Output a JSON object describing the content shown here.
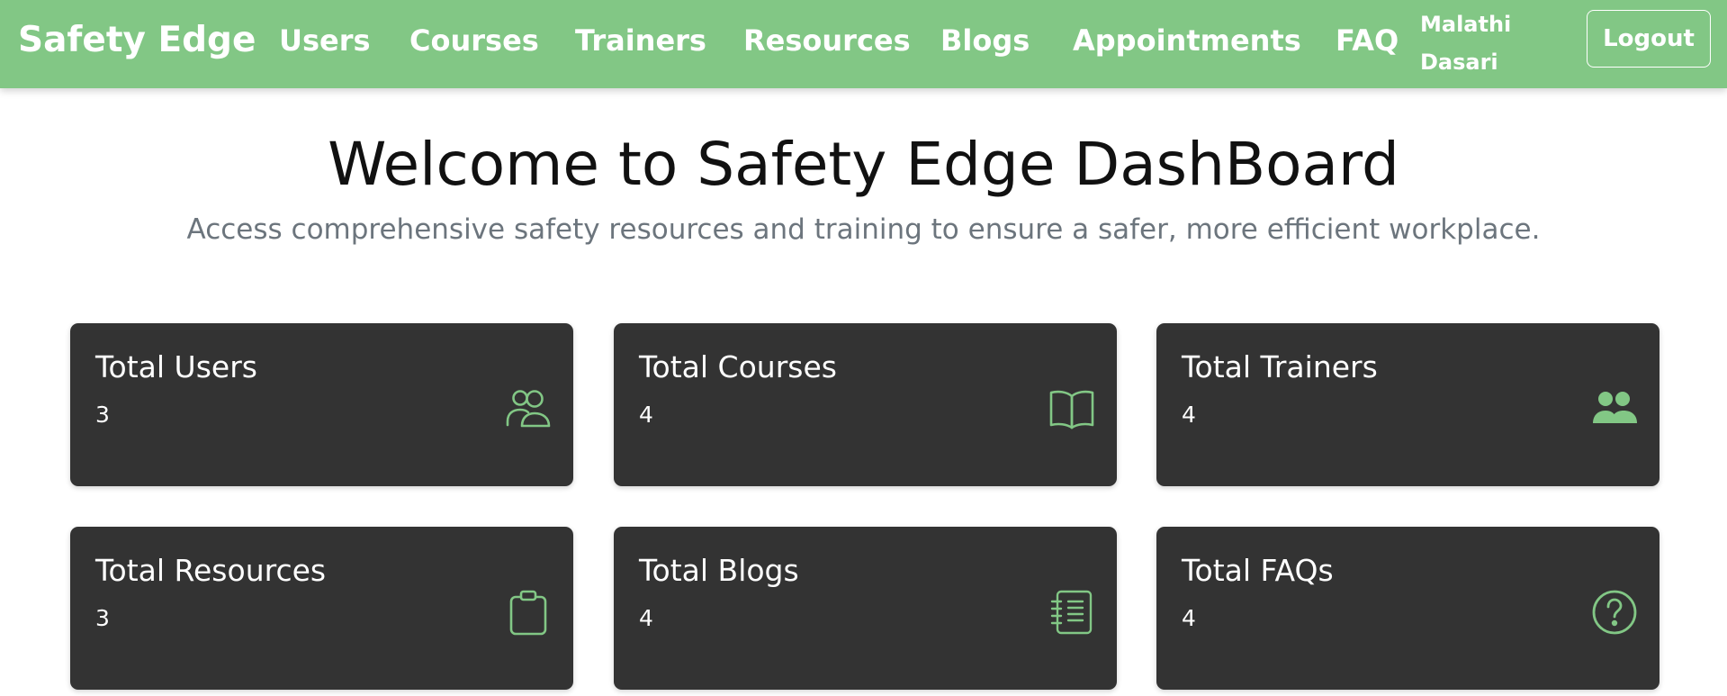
{
  "nav": {
    "brand": "Safety Edge",
    "links": [
      "Users",
      "Courses",
      "Trainers",
      "Resources",
      "Blogs",
      "Appointments",
      "FAQ"
    ],
    "user_name": "Malathi Dasari",
    "logout_label": "Logout"
  },
  "hero": {
    "title": "Welcome to Safety Edge DashBoard",
    "subtitle": "Access comprehensive safety resources and training to ensure a safer, more efficient workplace."
  },
  "cards": [
    {
      "title": "Total Users",
      "value": "3",
      "icon": "users-outline-icon"
    },
    {
      "title": "Total Courses",
      "value": "4",
      "icon": "book-open-icon"
    },
    {
      "title": "Total Trainers",
      "value": "4",
      "icon": "users-filled-icon"
    },
    {
      "title": "Total Resources",
      "value": "3",
      "icon": "clipboard-icon"
    },
    {
      "title": "Total Blogs",
      "value": "4",
      "icon": "journal-icon"
    },
    {
      "title": "Total FAQs",
      "value": "4",
      "icon": "question-circle-icon"
    }
  ],
  "colors": {
    "accent": "#82c785",
    "card_bg": "#333333",
    "subtitle": "#6c757d"
  }
}
